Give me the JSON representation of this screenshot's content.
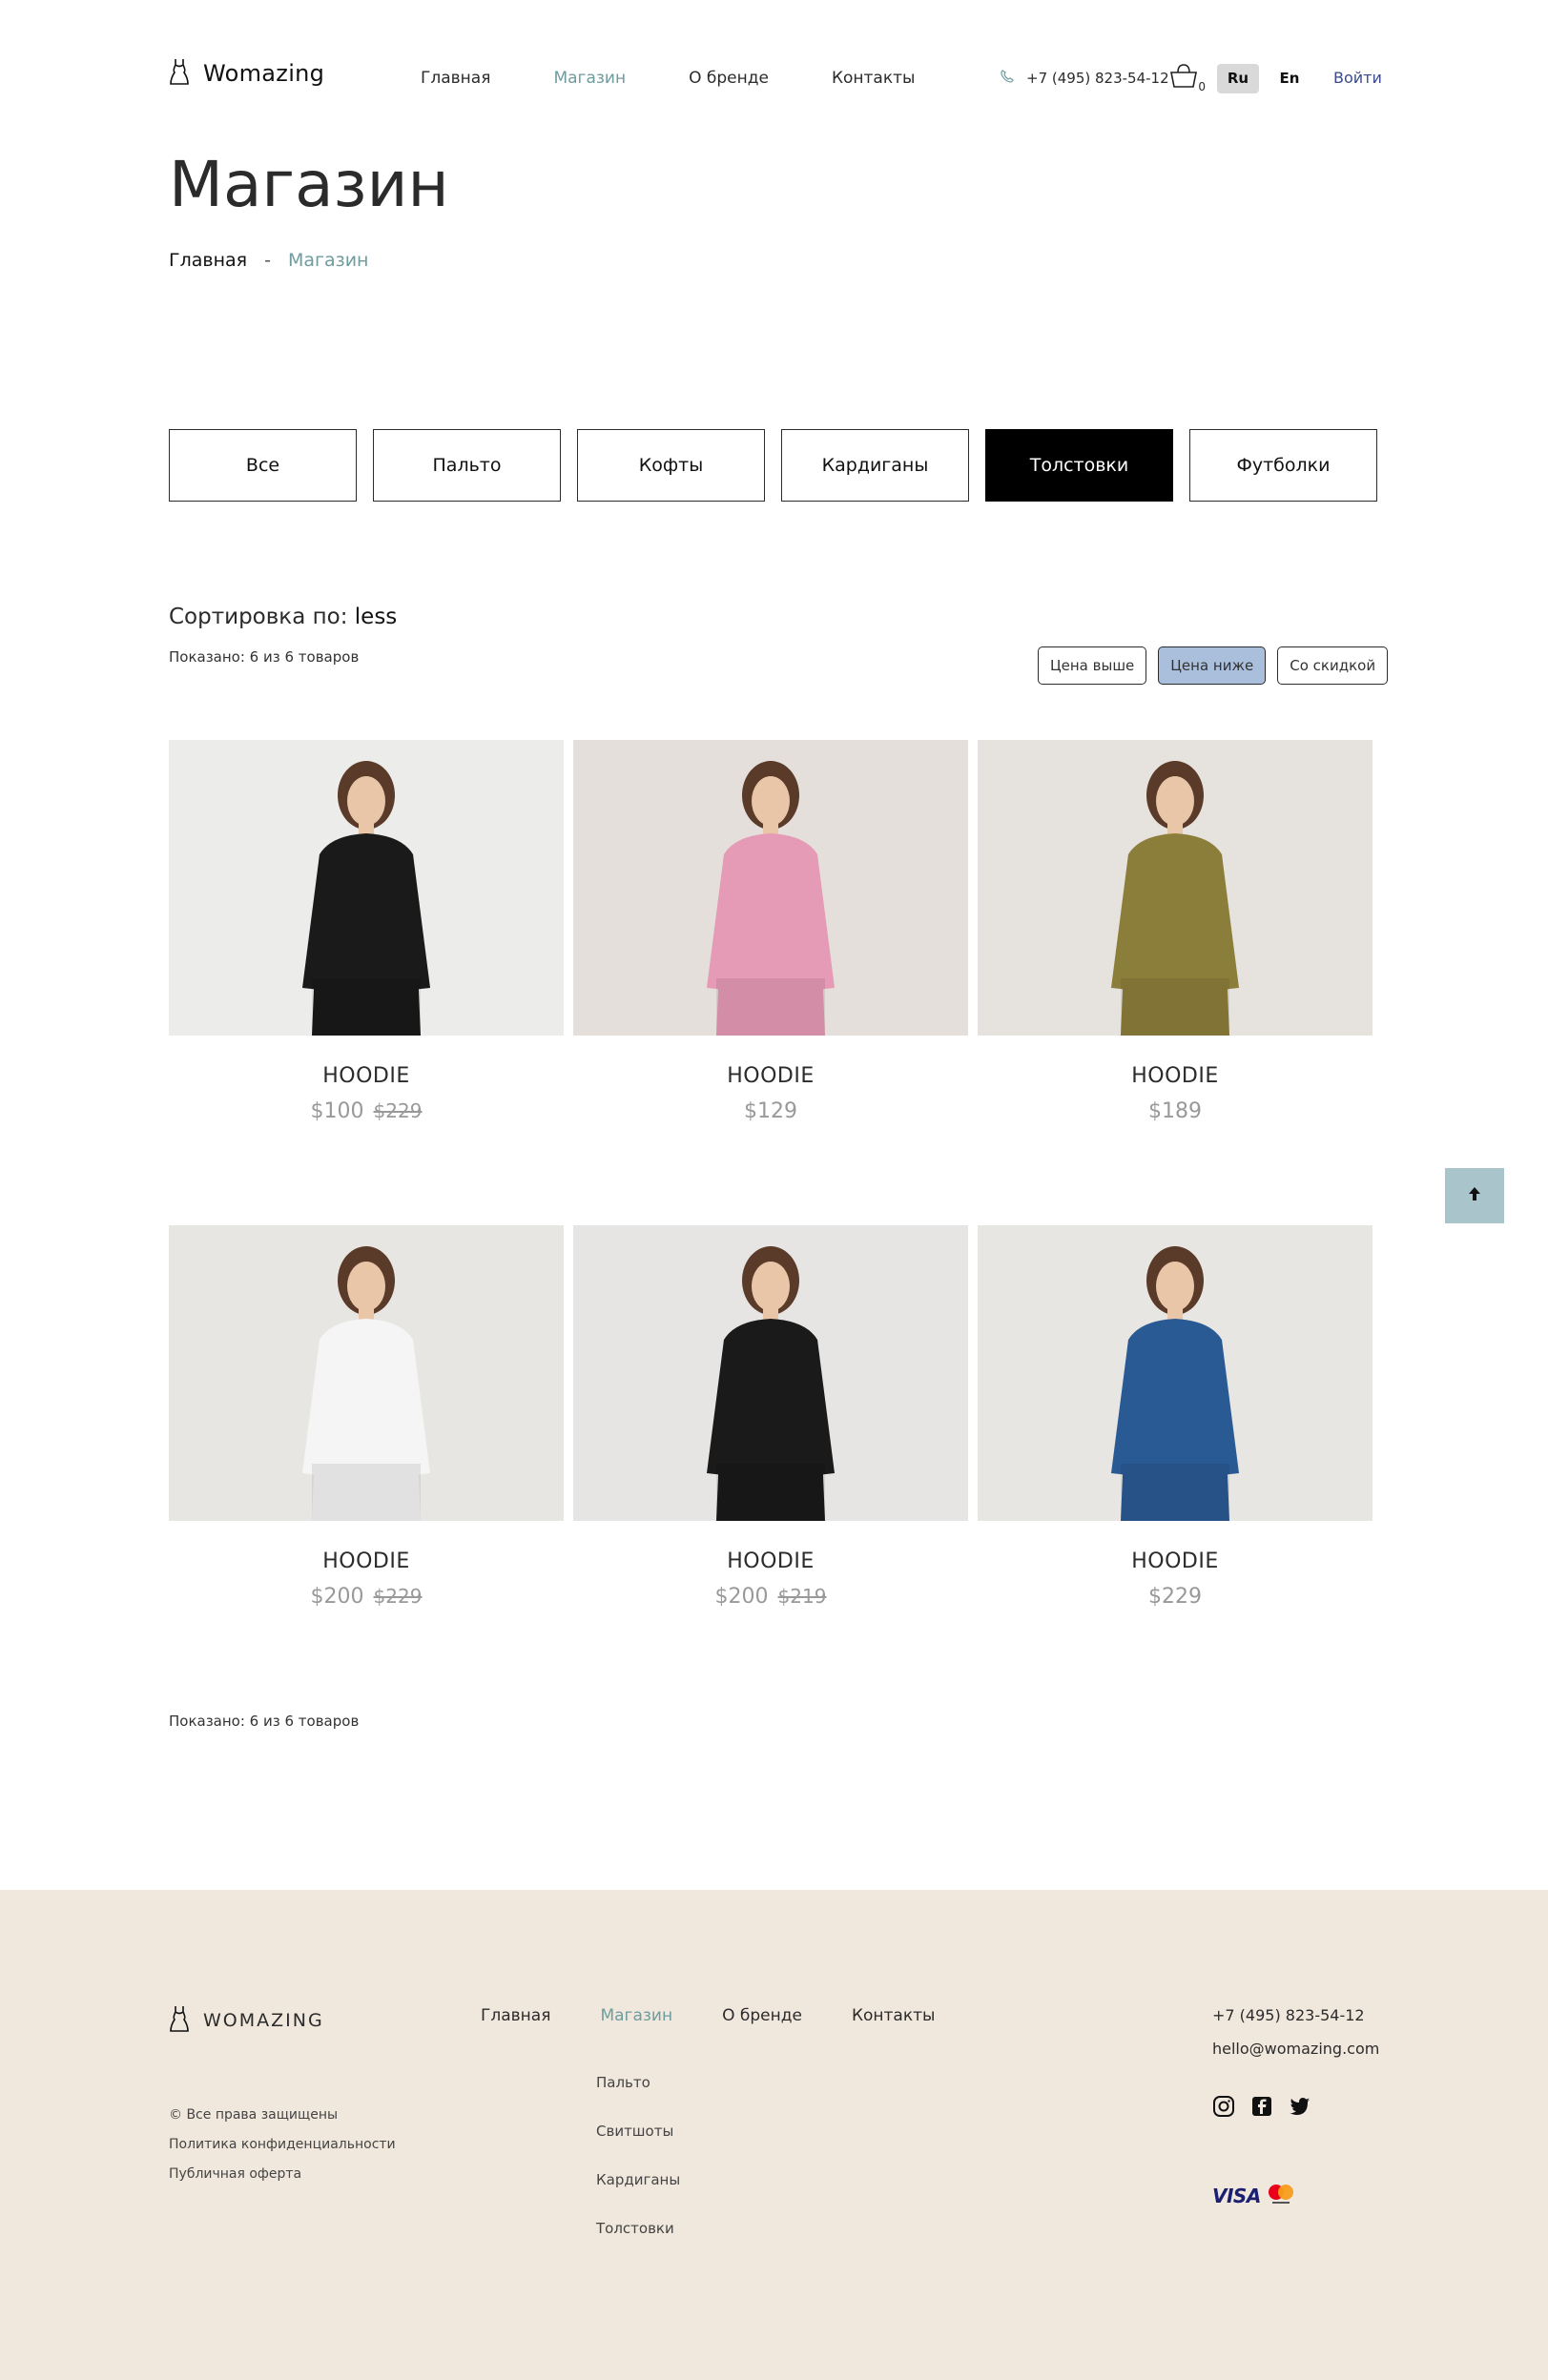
{
  "header": {
    "logo_text": "Womazing",
    "nav": [
      "Главная",
      "Магазин",
      "О бренде",
      "Контакты"
    ],
    "active_nav": 1,
    "phone": "+7 (495) 823-54-12",
    "cart_count": "0",
    "lang_ru": "Ru",
    "lang_en": "En",
    "login": "Войти"
  },
  "page": {
    "title": "Магазин",
    "breadcrumb_home": "Главная",
    "breadcrumb_sep": "-",
    "breadcrumb_current": "Магазин"
  },
  "categories": [
    "Все",
    "Пальто",
    "Кофты",
    "Кардиганы",
    "Толстовки",
    "Футболки"
  ],
  "active_category": 4,
  "sort": {
    "label": "Сортировка по: ",
    "value": "less",
    "shown_top": "Показано: 6 из 6 товаров",
    "shown_bottom": "Показано: 6 из 6 товаров",
    "buttons": [
      "Цена выше",
      "Цена ниже",
      "Со скидкой"
    ],
    "active_button": 1
  },
  "products": [
    {
      "name": "HOODIE",
      "price": "$100",
      "old_price": "$229",
      "color": "#1a1a1a",
      "bg": "#ececea"
    },
    {
      "name": "HOODIE",
      "price": "$129",
      "old_price": "",
      "color": "#e59ab5",
      "bg": "#e4dfdb"
    },
    {
      "name": "HOODIE",
      "price": "$189",
      "old_price": "",
      "color": "#8b7d3a",
      "bg": "#e6e2dd"
    },
    {
      "name": "HOODIE",
      "price": "$200",
      "old_price": "$229",
      "color": "#f5f5f5",
      "bg": "#e8e6e2"
    },
    {
      "name": "HOODIE",
      "price": "$200",
      "old_price": "$219",
      "color": "#1a1a1a",
      "bg": "#e6e5e3"
    },
    {
      "name": "HOODIE",
      "price": "$229",
      "old_price": "",
      "color": "#2a5a94",
      "bg": "#e8e6e3"
    }
  ],
  "footer": {
    "logo_text": "WOMAZING",
    "nav": [
      "Главная",
      "Магазин",
      "О бренде",
      "Контакты"
    ],
    "active_nav": 1,
    "sub_links": [
      "Пальто",
      "Свитшоты",
      "Кардиганы",
      "Толстовки"
    ],
    "copyright": "© Все права защищены",
    "privacy": "Политика конфиденциальности",
    "offer": "Публичная оферта",
    "phone": "+7 (495) 823-54-12",
    "email": "hello@womazing.com",
    "socials": [
      "instagram-icon",
      "facebook-icon",
      "twitter-icon"
    ],
    "visa": "VISA"
  },
  "colors": {
    "accent": "#6e9c9f",
    "footer_bg": "#f1e8dd",
    "active_sort": "#a9bfdc",
    "scroll_top": "#a9c5cb"
  }
}
